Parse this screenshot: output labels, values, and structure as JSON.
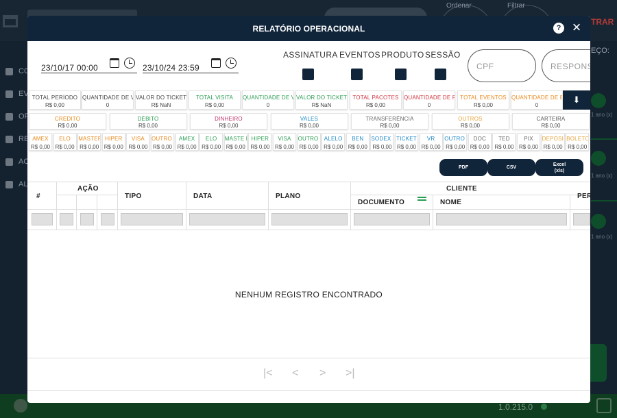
{
  "background": {
    "filters": {
      "order_label": "Ordenar",
      "filter_label": "Filtrar"
    },
    "header_link": "TRAR",
    "sidebar": [
      "CO",
      "EV",
      "OF",
      "RE",
      "AC",
      "AL"
    ],
    "right_label": "EÇO:",
    "right_tags": [
      "1 ano (x)",
      "1 ano (x)",
      "1 ano (x)"
    ],
    "footer": {
      "version": "1.0.215.0"
    }
  },
  "modal": {
    "title": "RELATÓRIO OPERACIONAL",
    "start_date": "23/10/17 00:00",
    "end_date": "23/10/24 23:59",
    "checkboxes": [
      "ASSINATURA",
      "EVENTOS",
      "PRODUTO",
      "SESSÃO"
    ],
    "cpf_placeholder": "CPF",
    "responsavel_placeholder": "RESPONSA..."
  },
  "totals_row1": [
    {
      "label": "TOTAL PERÍODO",
      "value": "R$ 0,00",
      "color": "#444444"
    },
    {
      "label": "QUANTIDADE DE VENDAS",
      "value": "0",
      "color": "#444444"
    },
    {
      "label": "VALOR DO TICKET MÉDIO GERAL",
      "value": "R$ NaN",
      "color": "#444444"
    },
    {
      "label": "TOTAL VISITA",
      "value": "R$ 0,00",
      "color": "#2a9d52"
    },
    {
      "label": "QUANTIDADE DE VISITAS",
      "value": "0",
      "color": "#2a9d52"
    },
    {
      "label": "VALOR DO TICKET MÉDIO VISITA",
      "value": "R$ NaN",
      "color": "#2a9d52"
    },
    {
      "label": "TOTAL PACOTES",
      "value": "R$ 0,00",
      "color": "#d0353f"
    },
    {
      "label": "QUANTIDADE DE PACOTES",
      "value": "0",
      "color": "#d0353f"
    },
    {
      "label": "TOTAL EVENTOS",
      "value": "R$ 0,00",
      "color": "#e8891b"
    },
    {
      "label": "QUANTIDADE DE EVENTOS",
      "value": "0",
      "color": "#e8891b"
    }
  ],
  "totals_row2": [
    {
      "label": "CRÉDITO",
      "value": "R$ 0,00",
      "color": "#e8891b"
    },
    {
      "label": "DÉBITO",
      "value": "R$ 0,00",
      "color": "#2a9d52"
    },
    {
      "label": "DINHEIRO",
      "value": "R$ 0,00",
      "color": "#c0336b"
    },
    {
      "label": "VALES",
      "value": "R$ 0,00",
      "color": "#1e88c8"
    },
    {
      "label": "TRANSFERÊNCIA",
      "value": "R$ 0,00",
      "color": "#666666"
    },
    {
      "label": "OUTROS",
      "value": "R$ 0,00",
      "color": "#e8a33b"
    },
    {
      "label": "CARTEIRA",
      "value": "R$ 0,00",
      "color": "#555555"
    }
  ],
  "totals_row3": [
    {
      "label": "AMEX",
      "value": "R$ 0,00",
      "color": "#e8891b"
    },
    {
      "label": "ELO",
      "value": "R$ 0,00",
      "color": "#e8891b"
    },
    {
      "label": "MASTER",
      "value": "R$ 0,00",
      "color": "#e8891b"
    },
    {
      "label": "HIPER",
      "value": "R$ 0,00",
      "color": "#e8891b"
    },
    {
      "label": "VISA",
      "value": "R$ 0,00",
      "color": "#e8891b"
    },
    {
      "label": "OUTRO S",
      "value": "R$ 0,00",
      "color": "#e8891b"
    },
    {
      "label": "AMEX",
      "value": "R$ 0,00",
      "color": "#2a9d52"
    },
    {
      "label": "ELO",
      "value": "R$ 0,00",
      "color": "#2a9d52"
    },
    {
      "label": "MASTE R",
      "value": "R$ 0,00",
      "color": "#2a9d52"
    },
    {
      "label": "HIPER",
      "value": "R$ 0,00",
      "color": "#2a9d52"
    },
    {
      "label": "VISA",
      "value": "R$ 0,00",
      "color": "#2a9d52"
    },
    {
      "label": "OUTRO S",
      "value": "R$ 0,00",
      "color": "#2a9d52"
    },
    {
      "label": "ALELO",
      "value": "R$ 0,00",
      "color": "#1e88c8"
    },
    {
      "label": "BEN",
      "value": "R$ 0,00",
      "color": "#1e88c8"
    },
    {
      "label": "SODEX O",
      "value": "R$ 0,00",
      "color": "#1e88c8"
    },
    {
      "label": "TICKET",
      "value": "R$ 0,00",
      "color": "#1e88c8"
    },
    {
      "label": "VR",
      "value": "R$ 0,00",
      "color": "#1e88c8"
    },
    {
      "label": "OUTRO S",
      "value": "R$ 0,00",
      "color": "#1e88c8"
    },
    {
      "label": "DOC",
      "value": "R$ 0,00",
      "color": "#666666"
    },
    {
      "label": "TED",
      "value": "R$ 0,00",
      "color": "#666666"
    },
    {
      "label": "PIX",
      "value": "R$ 0,00",
      "color": "#666666"
    },
    {
      "label": "DEPÓSI TO",
      "value": "R$ 0,00",
      "color": "#e8a33b"
    },
    {
      "label": "BOLETO",
      "value": "R$ 0,00",
      "color": "#e8a33b"
    }
  ],
  "export": {
    "pdf": "PDF",
    "csv": "CSV",
    "excel_line1": "Excel",
    "excel_line2": "(xls)"
  },
  "table": {
    "col_index": "#",
    "col_acao": "AÇÃO",
    "col_tipo": "TIPO",
    "col_data": "DATA",
    "col_plano": "PLANO",
    "col_cliente": "CLIENTE",
    "col_documento": "DOCUMENTO",
    "col_nome": "NOME",
    "col_per": "PER",
    "empty_message": "NENHUM REGISTRO ENCONTRADO"
  },
  "pager": {
    "first": "|<",
    "prev": "<",
    "next": ">",
    "last": ">|"
  }
}
